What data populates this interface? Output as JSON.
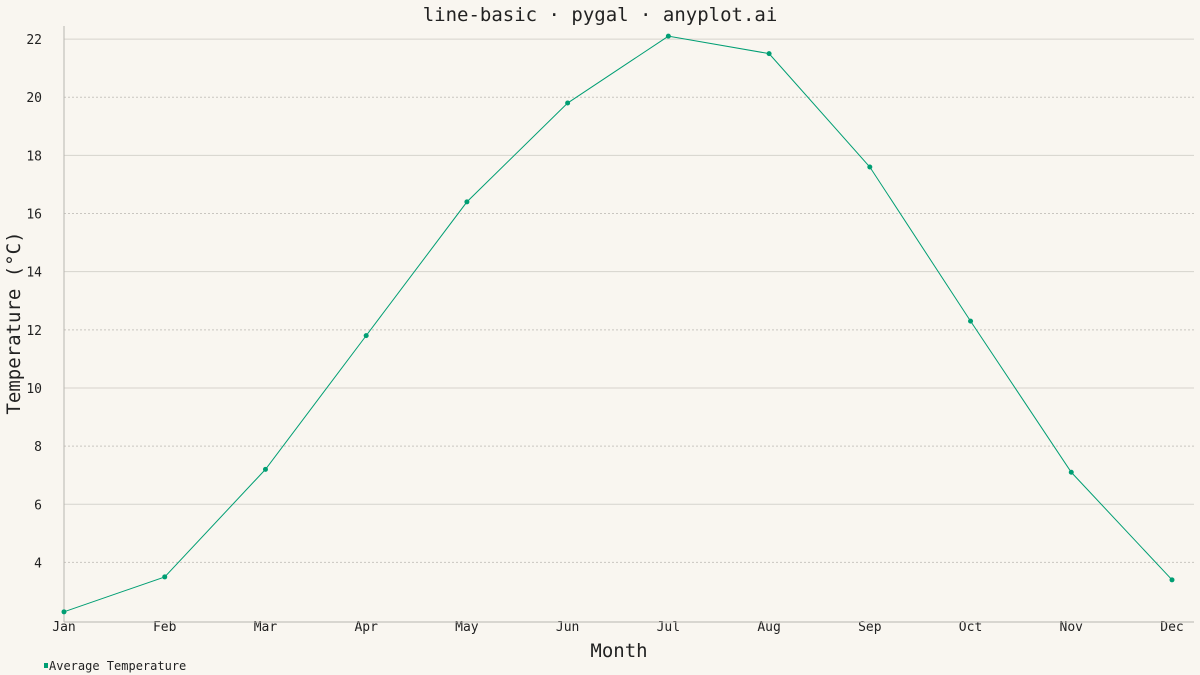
{
  "chart_data": {
    "type": "line",
    "title": "line-basic · pygal · anyplot.ai",
    "xlabel": "Month",
    "ylabel": "Temperature (°C)",
    "categories": [
      "Jan",
      "Feb",
      "Mar",
      "Apr",
      "May",
      "Jun",
      "Jul",
      "Aug",
      "Sep",
      "Oct",
      "Nov",
      "Dec"
    ],
    "series": [
      {
        "name": "Average Temperature",
        "color": "#009e73",
        "values": [
          2.3,
          3.5,
          7.2,
          11.8,
          16.4,
          19.8,
          22.1,
          21.5,
          17.6,
          12.3,
          7.1,
          3.4
        ]
      }
    ],
    "yticks": [
      4,
      6,
      8,
      10,
      12,
      14,
      16,
      18,
      20,
      22
    ],
    "ylim": [
      1.95,
      22.45
    ],
    "grid": true,
    "legend_position": "bottom-left"
  }
}
